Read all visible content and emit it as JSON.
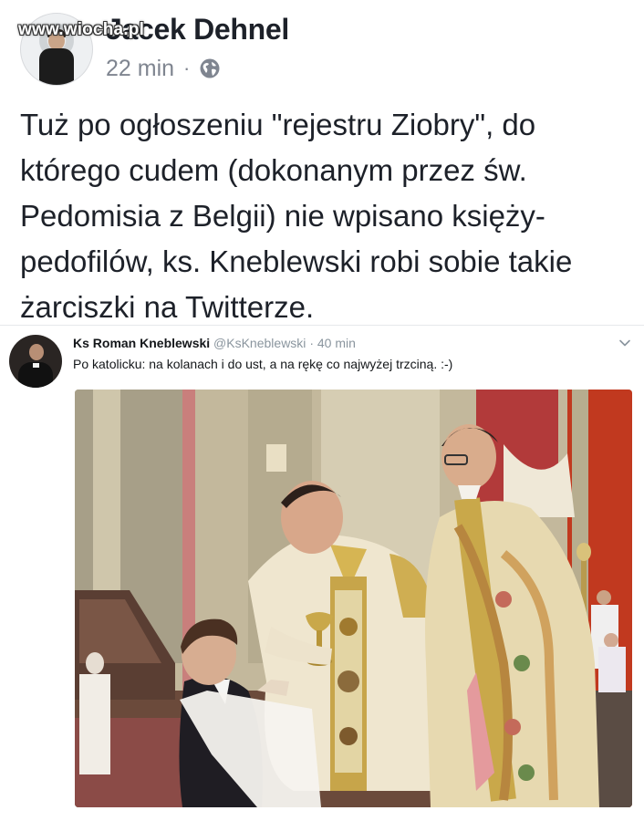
{
  "watermark": "www.wiocha.pl",
  "post": {
    "author": "Jacek Dehnel",
    "time": "22 min",
    "separator": "·",
    "privacy_icon": "globe-icon",
    "text": "Tuż po ogłoszeniu \"rejestru Ziobry\", do\nktórego cudem (dokonanym przez św.\nPedomisia z Belgii) nie wpisano księży-\npedofilów, ks. Kneblewski robi sobie takie\nżarciszki na Twitterze."
  },
  "tweet": {
    "name": "Ks Roman Kneblewski",
    "handle": "@KsKneblewski",
    "separator": "·",
    "time": "40 min",
    "text": "Po katolicku: na kolanach i do ust, a na rękę co najwyżej trzciną.  :-)",
    "menu_icon": "chevron-down-icon",
    "photo": "photo of priests giving communion to a kneeling boy in a church"
  },
  "colors": {
    "text_primary": "#1d2129",
    "text_secondary": "#7f8590",
    "tweet_meta": "#8a959e",
    "background": "#ffffff"
  }
}
